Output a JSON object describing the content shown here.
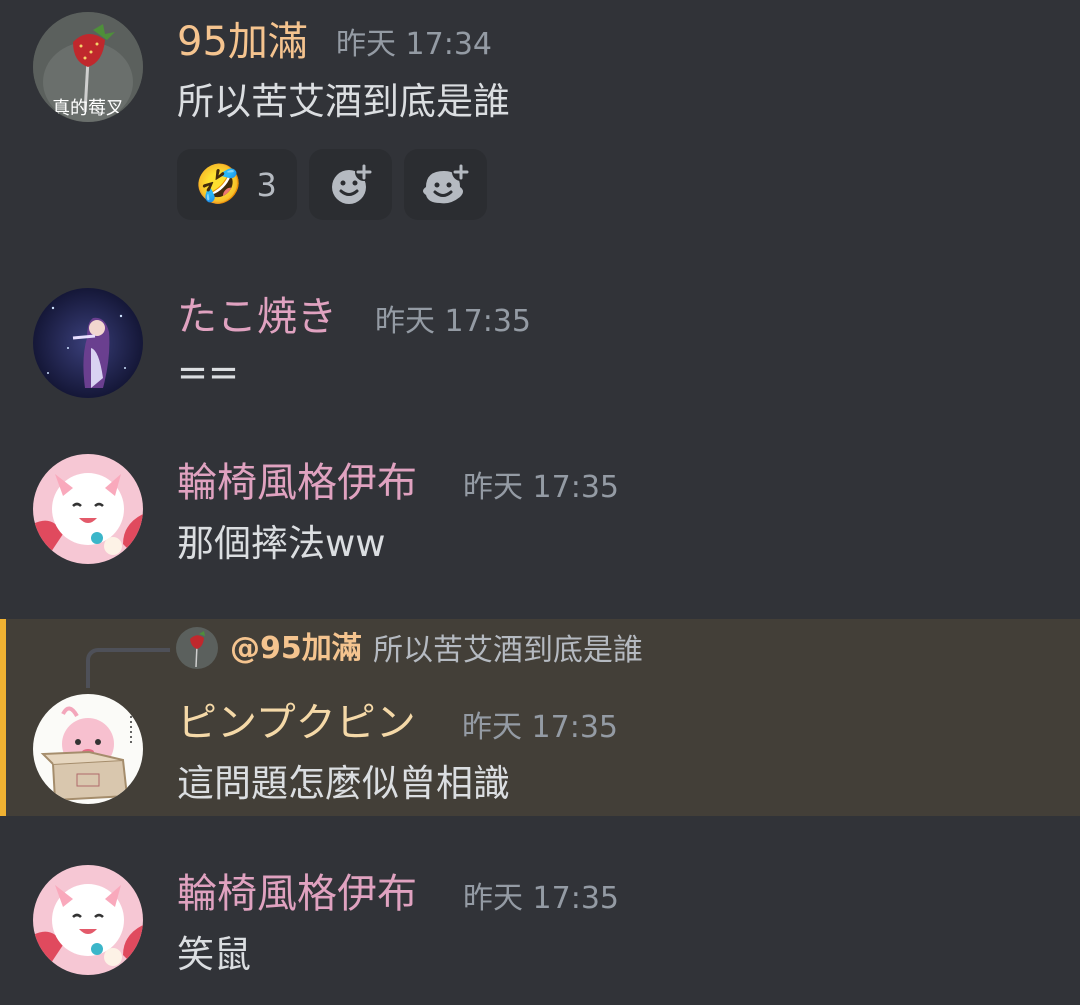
{
  "messages": [
    {
      "author": "95加滿",
      "author_color": "#f5c48f",
      "time": "昨天 17:34",
      "text": "所以苦艾酒到底是誰",
      "avatar_label": "真的莓叉",
      "reactions": [
        {
          "emoji": "🤣",
          "icon": "rolling-on-floor-laughing-emoji",
          "count": "3"
        },
        {
          "icon": "add-reaction-icon"
        },
        {
          "icon": "add-super-reaction-icon"
        }
      ]
    },
    {
      "author": "たこ焼き",
      "author_color": "#e0a2c0",
      "time": "昨天 17:35",
      "text": "=="
    },
    {
      "author": "輪椅風格伊布",
      "author_color": "#e0a2c0",
      "time": "昨天 17:35",
      "text": "那個摔法ww"
    },
    {
      "author": "ピンプクピン",
      "author_color": "#f5d9a8",
      "time": "昨天 17:35",
      "text": "這問題怎麼似曾相識",
      "reply": {
        "mention": "@95加滿",
        "text": "所以苦艾酒到底是誰"
      },
      "highlight_color": "#f0b232"
    },
    {
      "author": "輪椅風格伊布",
      "author_color": "#e0a2c0",
      "time": "昨天 17:35",
      "text": "笑鼠"
    }
  ]
}
